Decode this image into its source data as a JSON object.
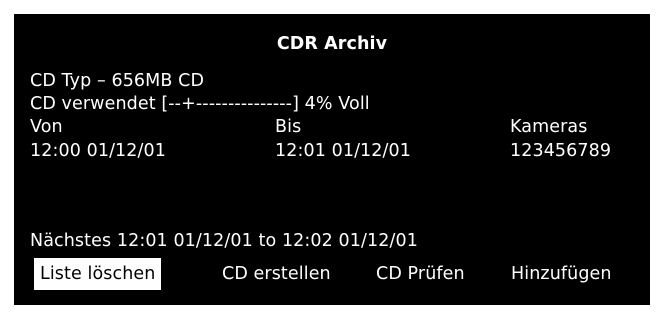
{
  "window": {
    "title": "CDR Archiv"
  },
  "cd_info": {
    "type_line": "CD Typ – 656MB CD",
    "usage_line": "CD verwendet [--+---------------] 4% Voll"
  },
  "range_table": {
    "headers": {
      "from": "Von",
      "to": "Bis",
      "cameras": "Kameras"
    },
    "values": {
      "from": "12:00 01/12/01",
      "to": "12:01 01/12/01",
      "cameras": "123456789"
    }
  },
  "next_line": "Nächstes 12:01 01/12/01 to 12:02 01/12/01",
  "actions": {
    "clear_list": "Liste löschen",
    "create_cd": "CD erstellen",
    "verify_cd": "CD Prüfen",
    "add": "Hinzufügen"
  },
  "colors": {
    "background": "#000000",
    "text": "#ffffff",
    "selected_background": "#ffffff",
    "selected_text": "#000000"
  }
}
